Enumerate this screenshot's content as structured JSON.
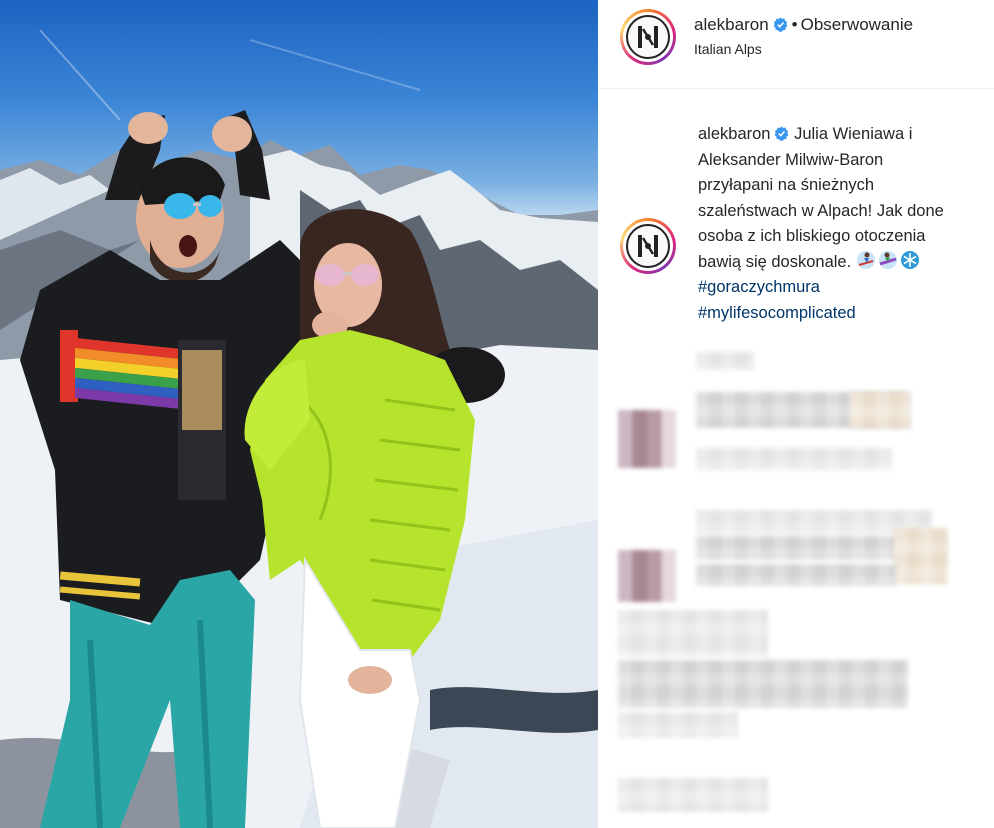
{
  "post": {
    "username": "alekbaron",
    "separator": "•",
    "follow_label": "Obserwowanie",
    "location": "Italian Alps",
    "caption_lines": [
      "Julia Wieniawa i",
      "Aleksander Milwiw-Baron",
      "przyłapani na śnieżnych",
      "szaleństwach w Alpach! Jak done",
      "osoba z ich bliskiego otoczenia",
      "bawią się doskonale."
    ],
    "hashtags": [
      "#goraczychmura",
      "#mylifesocomplicated"
    ],
    "emoji_icons": [
      "skier-emoji-icon",
      "snowboarder-emoji-icon",
      "snowflake-emoji-icon"
    ]
  },
  "colors": {
    "verified_badge": "#3897f0",
    "hashtag": "#003569",
    "text": "#262626"
  },
  "icons": [
    "verified-badge-icon",
    "avatar-logo-icon"
  ]
}
